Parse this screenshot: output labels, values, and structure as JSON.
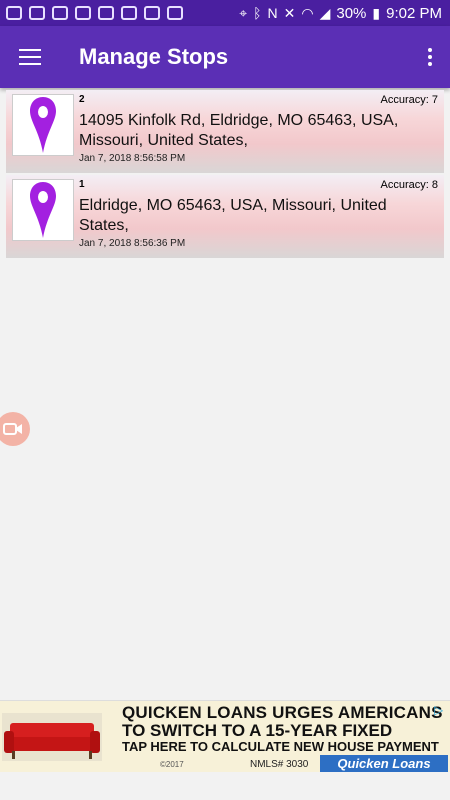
{
  "status_bar": {
    "battery": "30%",
    "time": "9:02 PM"
  },
  "app_bar": {
    "title": "Manage Stops"
  },
  "stops": [
    {
      "number": "2",
      "accuracy": "Accuracy: 7",
      "address": "14095 Kinfolk Rd, Eldridge, MO 65463, USA, Missouri, United States,",
      "timestamp": "Jan 7, 2018 8:56:58 PM"
    },
    {
      "number": "1",
      "accuracy": "Accuracy: 8",
      "address": "Eldridge, MO 65463, USA, Missouri, United States,",
      "timestamp": "Jan 7, 2018 8:56:36 PM"
    }
  ],
  "ad": {
    "line1": "QUICKEN LOANS URGES AMERICANS",
    "line2": "TO SWITCH TO A 15-YEAR FIXED",
    "line3": "TAP HERE TO CALCULATE NEW HOUSE PAYMENT",
    "year": "©2017",
    "nmls": "NMLS# 3030",
    "brand": "Quicken Loans"
  },
  "colors": {
    "status_bar": "#4a1fa0",
    "app_bar": "#5b2fb5",
    "pin": "#a320e0"
  }
}
